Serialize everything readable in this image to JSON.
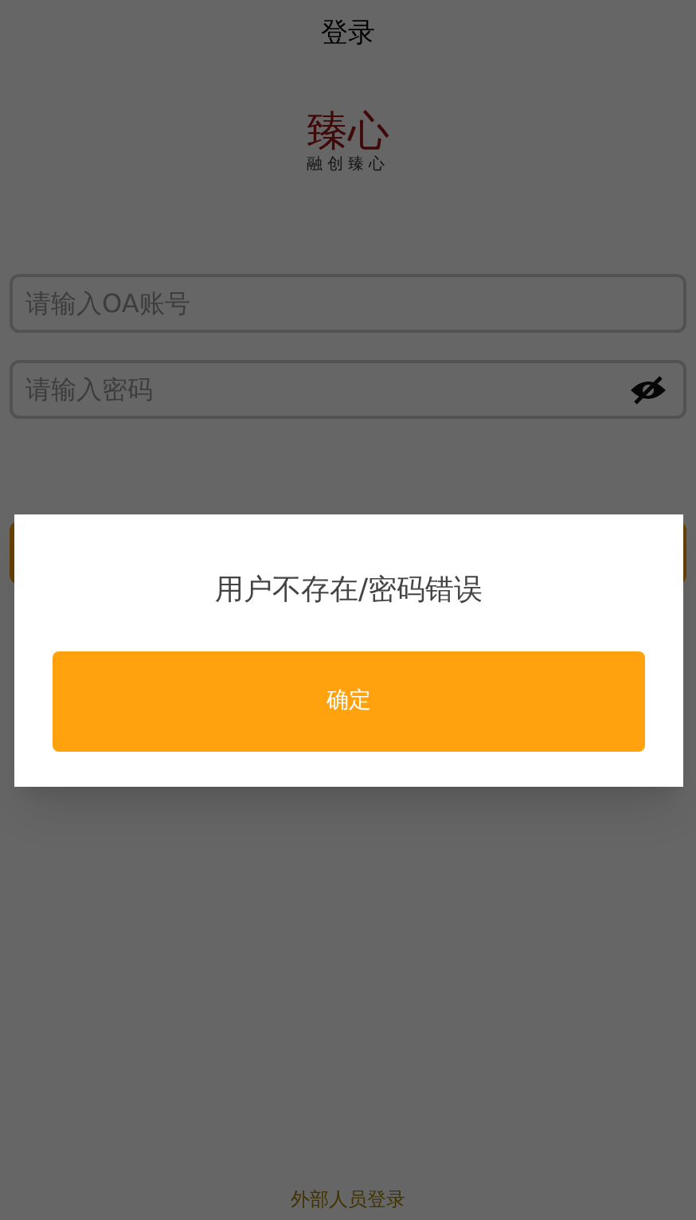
{
  "header": {
    "title": "登录"
  },
  "logo": {
    "mark": "臻心",
    "tagline": "融创臻心"
  },
  "form": {
    "account": {
      "placeholder": "请输入OA账号"
    },
    "password": {
      "placeholder": "请输入密码",
      "visible": false
    }
  },
  "footer": {
    "link": "外部人员登录"
  },
  "dialog": {
    "message": "用户不存在/密码错误",
    "button": "确定"
  }
}
